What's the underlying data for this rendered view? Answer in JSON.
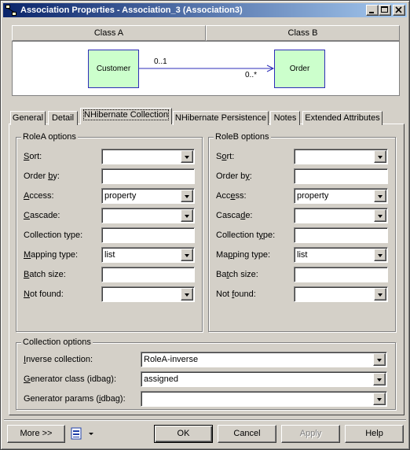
{
  "window": {
    "title": "Association Properties - Association_3 (Association3)"
  },
  "header": {
    "class_a": "Class A",
    "class_b": "Class B"
  },
  "diagram": {
    "class_a_name": "Customer",
    "class_b_name": "Order",
    "mult_a": "0..1",
    "mult_b": "0..*"
  },
  "tabs": [
    {
      "label": "General"
    },
    {
      "label": "Detail"
    },
    {
      "label": "NHibernate Collection"
    },
    {
      "label": "NHibernate Persistence"
    },
    {
      "label": "Notes"
    },
    {
      "label": "Extended Attributes"
    }
  ],
  "roleA": {
    "title": "RoleA options",
    "fields": [
      {
        "label": "Sort:",
        "value": ""
      },
      {
        "label": "Order by:",
        "value": ""
      },
      {
        "label": "Access:",
        "value": "property"
      },
      {
        "label": "Cascade:",
        "value": ""
      },
      {
        "label": "Collection type:",
        "value": ""
      },
      {
        "label": "Mapping type:",
        "value": "list"
      },
      {
        "label": "Batch size:",
        "value": ""
      },
      {
        "label": "Not found:",
        "value": ""
      }
    ]
  },
  "roleB": {
    "title": "RoleB options",
    "fields": [
      {
        "label": "Sort:",
        "value": ""
      },
      {
        "label": "Order by:",
        "value": ""
      },
      {
        "label": "Access:",
        "value": "property"
      },
      {
        "label": "Cascade:",
        "value": ""
      },
      {
        "label": "Collection type:",
        "value": ""
      },
      {
        "label": "Mapping type:",
        "value": "list"
      },
      {
        "label": "Batch size:",
        "value": ""
      },
      {
        "label": "Not found:",
        "value": ""
      }
    ]
  },
  "collection": {
    "title": "Collection options",
    "fields": [
      {
        "label": "Inverse collection:",
        "value": "RoleA-inverse"
      },
      {
        "label": "Generator class (idbag):",
        "value": "assigned"
      },
      {
        "label": "Generator params (idbag):",
        "value": ""
      }
    ]
  },
  "buttons": {
    "more": "More >>",
    "ok": "OK",
    "cancel": "Cancel",
    "apply": "Apply",
    "help": "Help"
  }
}
